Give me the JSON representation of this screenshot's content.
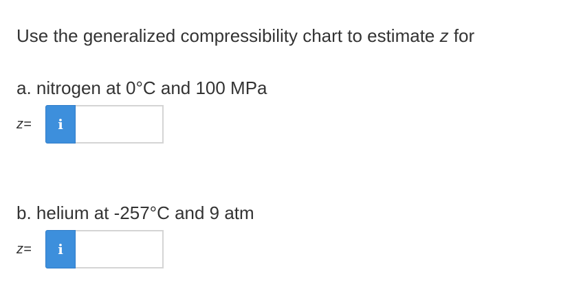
{
  "question": {
    "prefix": "Use the generalized compressibility chart to estimate ",
    "variable": "z",
    "suffix": " for"
  },
  "parts": [
    {
      "label": "a. nitrogen at 0°C and 100 MPa",
      "answer_label": "z=",
      "info_icon": "i",
      "value": ""
    },
    {
      "label": "b. helium at -257°C and 9 atm",
      "answer_label": "z=",
      "info_icon": "i",
      "value": ""
    }
  ],
  "colors": {
    "info_button": "#3d8fdc",
    "text": "#333333",
    "input_border": "#d4d4d4"
  }
}
